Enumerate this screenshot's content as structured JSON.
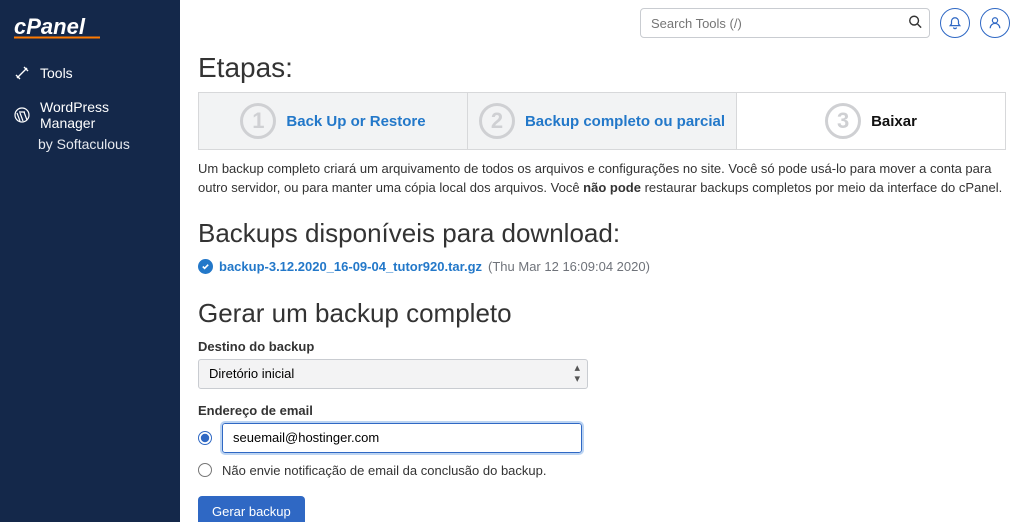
{
  "sidebar": {
    "logo_text": "cPanel",
    "items": [
      {
        "label": "Tools",
        "icon": "tools-icon"
      },
      {
        "label": "WordPress Manager",
        "icon": "wordpress-icon"
      }
    ],
    "sub_label": "by Softaculous"
  },
  "topbar": {
    "search_placeholder": "Search Tools (/)"
  },
  "steps": {
    "title": "Etapas:",
    "items": [
      {
        "num": "1",
        "label": "Back Up or Restore"
      },
      {
        "num": "2",
        "label": "Backup completo ou parcial"
      },
      {
        "num": "3",
        "label": "Baixar"
      }
    ],
    "active_index": 2
  },
  "description": {
    "pre": "Um backup completo criará um arquivamento de todos os arquivos e configurações no site. Você só pode usá-lo para mover a conta para outro servidor, ou para manter uma cópia local dos arquivos. Você ",
    "bold": "não pode",
    "post": " restaurar backups completos por meio da interface do cPanel."
  },
  "downloads": {
    "title": "Backups disponíveis para download:",
    "file": "backup-3.12.2020_16-09-04_tutor920.tar.gz",
    "meta": "(Thu Mar 12 16:09:04 2020)"
  },
  "generate": {
    "title": "Gerar um backup completo",
    "dest_label": "Destino do backup",
    "dest_value": "Diretório inicial",
    "email_label": "Endereço de email",
    "email_value": "seuemail@hostinger.com",
    "no_notify_label": "Não envie notificação de email da conclusão do backup.",
    "button": "Gerar backup"
  }
}
